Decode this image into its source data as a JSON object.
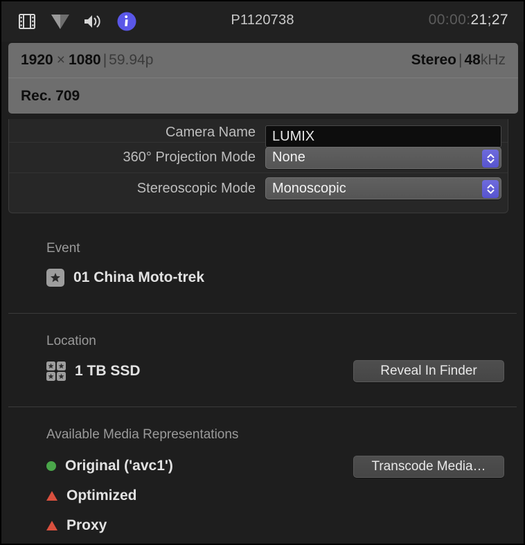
{
  "header": {
    "icons": [
      {
        "name": "film-strip-icon",
        "label": "Video"
      },
      {
        "name": "triangle-filter-icon",
        "label": "Filter"
      },
      {
        "name": "speaker-icon",
        "label": "Audio"
      },
      {
        "name": "info-icon",
        "label": "Info"
      }
    ],
    "clip_title": "P1120738",
    "timecode_dim": "00:00:",
    "timecode_bright": "21;27",
    "info_icon_color": "#5a57e8"
  },
  "info_band": {
    "rows": [
      {
        "left": {
          "width": "1920",
          "times": "×",
          "height": "1080",
          "separator": "|",
          "framerate": "59.94p"
        },
        "right": {
          "channels": "Stereo",
          "separator": "|",
          "rate_number": "48",
          "rate_unit": "kHz"
        }
      },
      {
        "left": {
          "colorspace": "Rec. 709"
        }
      }
    ]
  },
  "properties": [
    {
      "label": "Camera Name",
      "control": "text-field",
      "value": "LUMIX"
    },
    {
      "label": "360° Projection Mode",
      "control": "popup",
      "value": "None"
    },
    {
      "label": "Stereoscopic Mode",
      "control": "popup",
      "value": "Monoscopic"
    }
  ],
  "event": {
    "title": "Event",
    "name": "01 China Moto-trek",
    "icon": "event-star-icon"
  },
  "location": {
    "title": "Location",
    "name": "1 TB SSD",
    "icon": "library-grid-icon",
    "button": "Reveal In Finder"
  },
  "media": {
    "title": "Available Media Representations",
    "button": "Transcode Media…",
    "items": [
      {
        "label": "Original ('avc1')",
        "status": "available",
        "marker": "dot",
        "color": "#4aa64a"
      },
      {
        "label": "Optimized",
        "status": "missing",
        "marker": "triangle",
        "color": "#d9503e"
      },
      {
        "label": "Proxy",
        "status": "missing",
        "marker": "triangle",
        "color": "#d9503e"
      }
    ]
  }
}
